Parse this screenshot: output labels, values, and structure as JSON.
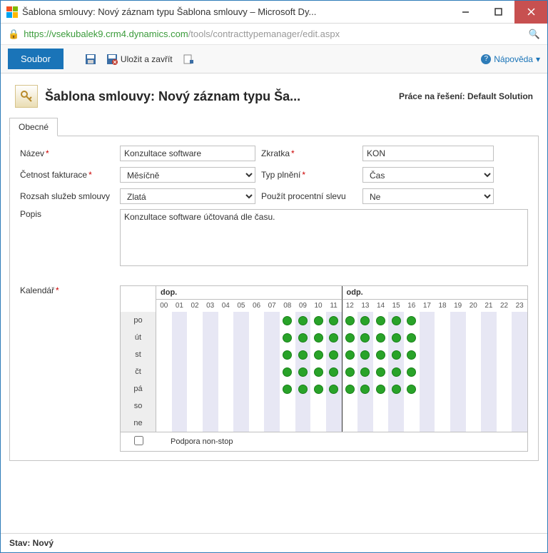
{
  "window": {
    "title": "Šablona smlouvy: Nový záznam typu Šablona smlouvy – Microsoft Dy..."
  },
  "address": {
    "secure_host": "https://vsekubalek9.crm4.dynamics.com",
    "path": "/tools/contracttypemanager/edit.aspx"
  },
  "toolbar": {
    "file": "Soubor",
    "save_close": "Uložit a zavřít"
  },
  "help": {
    "label": "Nápověda"
  },
  "header": {
    "title": "Šablona smlouvy: Nový záznam typu Ša...",
    "solution": "Práce na řešení: Default Solution"
  },
  "tabs": {
    "general": "Obecné"
  },
  "fields": {
    "name_label": "Název",
    "name_value": "Konzultace software",
    "abbr_label": "Zkratka",
    "abbr_value": "KON",
    "billfreq_label": "Četnost fakturace",
    "billfreq_value": "Měsíčně",
    "alloc_label": "Typ plnění",
    "alloc_value": "Čas",
    "svclvl_label": "Rozsah služeb smlouvy",
    "svclvl_value": "Zlatá",
    "discount_label": "Použít procentní slevu",
    "discount_value": "Ne",
    "desc_label": "Popis",
    "desc_value": "Konzultace software účtovaná dle času."
  },
  "calendar": {
    "label": "Kalendář",
    "am": "dop.",
    "pm": "odp.",
    "hours": [
      "00",
      "01",
      "02",
      "03",
      "04",
      "05",
      "06",
      "07",
      "08",
      "09",
      "10",
      "11",
      "12",
      "13",
      "14",
      "15",
      "16",
      "17",
      "18",
      "19",
      "20",
      "21",
      "22",
      "23"
    ],
    "days": [
      "po",
      "út",
      "st",
      "čt",
      "pá",
      "so",
      "ne"
    ],
    "nonstop_label": "Podpora non-stop",
    "nonstop_checked": false,
    "schedule": {
      "po": [
        8,
        9,
        10,
        11,
        12,
        13,
        14,
        15,
        16
      ],
      "út": [
        8,
        9,
        10,
        11,
        12,
        13,
        14,
        15,
        16
      ],
      "st": [
        8,
        9,
        10,
        11,
        12,
        13,
        14,
        15,
        16
      ],
      "čt": [
        8,
        9,
        10,
        11,
        12,
        13,
        14,
        15,
        16
      ],
      "pá": [
        8,
        9,
        10,
        11,
        12,
        13,
        14,
        15,
        16
      ],
      "so": [],
      "ne": []
    }
  },
  "status": {
    "label": "Stav: Nový"
  }
}
